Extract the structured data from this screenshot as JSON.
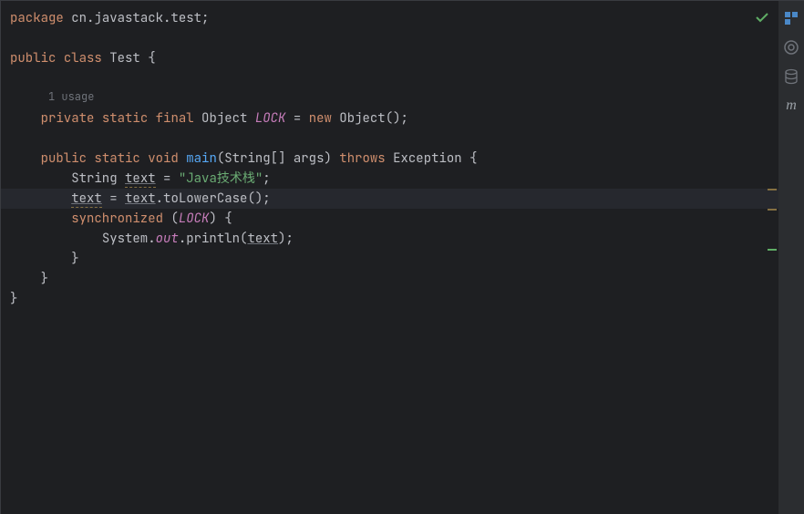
{
  "code": {
    "package_kw": "package",
    "package_name": "cn.javastack.test",
    "public_kw": "public",
    "class_kw": "class",
    "class_name": "Test",
    "usage_hint": "1 usage",
    "private_kw": "private",
    "static_kw": "static",
    "final_kw": "final",
    "object_type": "Object",
    "lock_field": "LOCK",
    "new_kw": "new",
    "void_kw": "void",
    "main_method": "main",
    "string_arr": "String[]",
    "args_param": "args",
    "throws_kw": "throws",
    "exception_type": "Exception",
    "string_type": "String",
    "text_var": "text",
    "string_literal": "\"Java技术栈\"",
    "tolowercase": "toLowerCase",
    "synchronized_kw": "synchronized",
    "system_cls": "System",
    "out_field": "out",
    "println_method": "println"
  },
  "icons": {
    "check": "check-icon",
    "structure": "structure-icon",
    "ai": "ai-icon",
    "database": "database-icon",
    "maven": "maven-icon"
  }
}
